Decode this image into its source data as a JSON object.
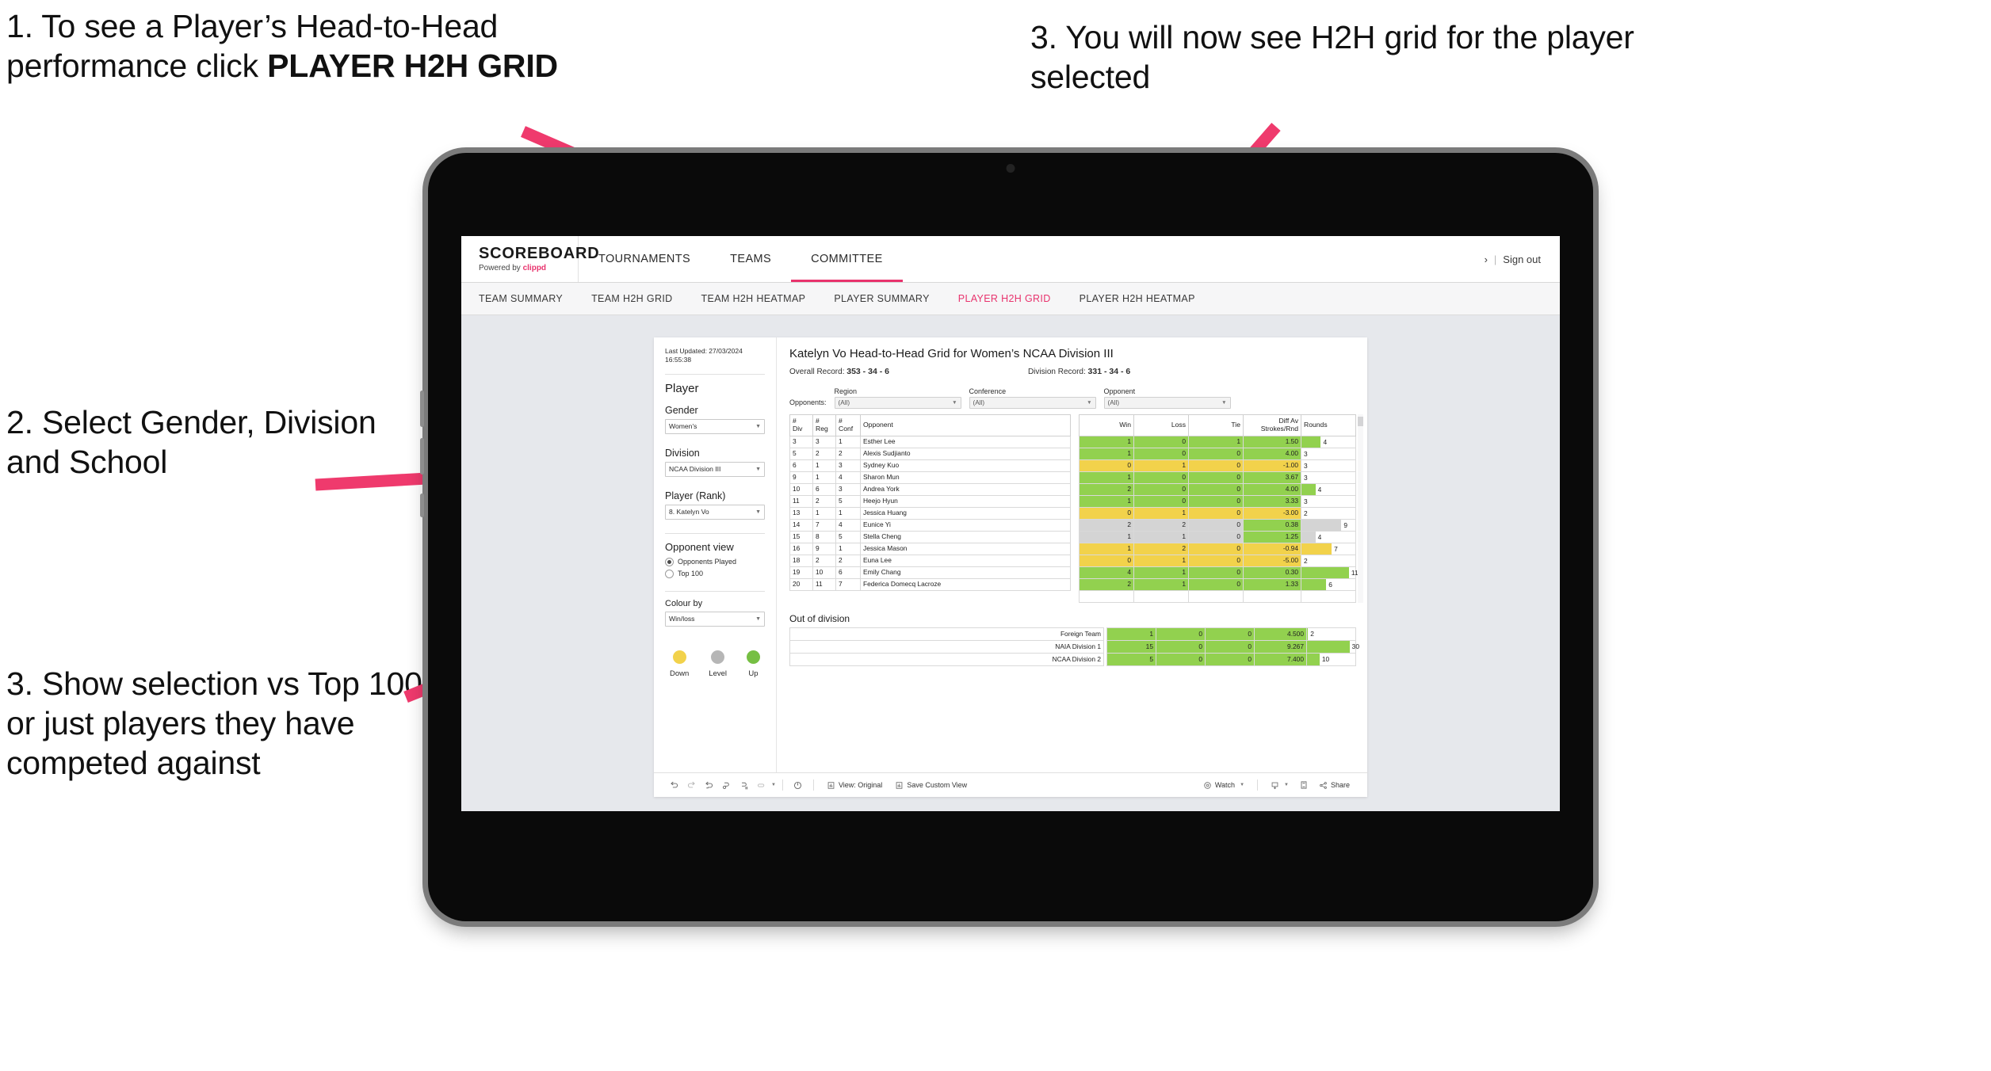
{
  "annotations": {
    "a1_prefix": "1. To see a Player’s Head-to-Head performance click ",
    "a1_bold": "PLAYER H2H GRID",
    "a2": "2. Select Gender, Division and School",
    "a3": "3. Show selection vs Top 100 or just players they have competed against",
    "a4": "3. You will now see H2H grid for the player selected",
    "arrow_color": "#ef3a6d"
  },
  "app": {
    "logo": {
      "main": "SCOREBOARD",
      "powered_prefix": "Powered by ",
      "brand": "clippd"
    },
    "top_nav": [
      {
        "label": "TOURNAMENTS",
        "active": false
      },
      {
        "label": "TEAMS",
        "active": false
      },
      {
        "label": "COMMITTEE",
        "active": true
      }
    ],
    "header_right": {
      "chevron": "›",
      "separator": "|",
      "sign_out": "Sign out"
    },
    "sub_nav": [
      {
        "label": "TEAM SUMMARY",
        "active": false
      },
      {
        "label": "TEAM H2H GRID",
        "active": false
      },
      {
        "label": "TEAM H2H HEATMAP",
        "active": false
      },
      {
        "label": "PLAYER SUMMARY",
        "active": false
      },
      {
        "label": "PLAYER H2H GRID",
        "active": true
      },
      {
        "label": "PLAYER H2H HEATMAP",
        "active": false
      }
    ],
    "accent_color": "#e8336d"
  },
  "sidebar": {
    "last_updated": "Last Updated: 27/03/2024 16:55:38",
    "player_heading": "Player",
    "gender": {
      "label": "Gender",
      "value": "Women's"
    },
    "division": {
      "label": "Division",
      "value": "NCAA Division III"
    },
    "player_rank": {
      "label": "Player (Rank)",
      "value": "8. Katelyn Vo"
    },
    "opponent_view": {
      "heading": "Opponent view",
      "options": [
        {
          "label": "Opponents Played",
          "selected": true
        },
        {
          "label": "Top 100",
          "selected": false
        }
      ]
    },
    "colour_by": {
      "label": "Colour by",
      "value": "Win/loss"
    },
    "legend": [
      {
        "label": "Down",
        "color": "#f2d24b"
      },
      {
        "label": "Level",
        "color": "#b6b6b6"
      },
      {
        "label": "Up",
        "color": "#76bf43"
      }
    ]
  },
  "main": {
    "title": "Katelyn Vo Head-to-Head Grid for Women’s NCAA Division III",
    "overall_record": {
      "label": "Overall Record:",
      "value": "353 - 34 - 6"
    },
    "division_record": {
      "label": "Division Record:",
      "value": "331 - 34 - 6"
    },
    "opponents_label": "Opponents:",
    "filters": [
      {
        "label": "Region",
        "value": "(All)"
      },
      {
        "label": "Conference",
        "value": "(All)"
      },
      {
        "label": "Opponent",
        "value": "(All)"
      }
    ],
    "out_of_division_title": "Out of division"
  },
  "chart_data": {
    "type": "table",
    "title": "Katelyn Vo Head-to-Head Grid for Women’s NCAA Division III",
    "columns": [
      "# Div",
      "# Reg",
      "# Conf",
      "Opponent",
      "Win",
      "Loss",
      "Tie",
      "Diff Av Strokes/Rnd",
      "Rounds"
    ],
    "column_headers_two_line": [
      [
        "#",
        "Div"
      ],
      [
        "#",
        "Reg"
      ],
      [
        "#",
        "Conf"
      ],
      [
        "Opponent",
        ""
      ],
      [
        "Win",
        ""
      ],
      [
        "Loss",
        ""
      ],
      [
        "Tie",
        ""
      ],
      [
        "Diff Av",
        "Strokes/Rnd"
      ],
      [
        "Rounds",
        ""
      ]
    ],
    "rows": [
      {
        "div": "3",
        "reg": "3",
        "conf": "1",
        "opponent": "Esther Lee",
        "win": "1",
        "loss": "0",
        "tie": "1",
        "diff": "1.50",
        "rounds": "4",
        "state": "up",
        "bar_pct": 36
      },
      {
        "div": "5",
        "reg": "2",
        "conf": "2",
        "opponent": "Alexis Sudjianto",
        "win": "1",
        "loss": "0",
        "tie": "0",
        "diff": "4.00",
        "rounds": "3",
        "state": "up",
        "bar_pct": 0
      },
      {
        "div": "6",
        "reg": "1",
        "conf": "3",
        "opponent": "Sydney Kuo",
        "win": "0",
        "loss": "1",
        "tie": "0",
        "diff": "-1.00",
        "rounds": "3",
        "state": "down",
        "bar_pct": 0
      },
      {
        "div": "9",
        "reg": "1",
        "conf": "4",
        "opponent": "Sharon Mun",
        "win": "1",
        "loss": "0",
        "tie": "0",
        "diff": "3.67",
        "rounds": "3",
        "state": "up",
        "bar_pct": 0
      },
      {
        "div": "10",
        "reg": "6",
        "conf": "3",
        "opponent": "Andrea York",
        "win": "2",
        "loss": "0",
        "tie": "0",
        "diff": "4.00",
        "rounds": "4",
        "state": "up",
        "bar_pct": 26
      },
      {
        "div": "11",
        "reg": "2",
        "conf": "5",
        "opponent": "Heejo Hyun",
        "win": "1",
        "loss": "0",
        "tie": "0",
        "diff": "3.33",
        "rounds": "3",
        "state": "up",
        "bar_pct": 0
      },
      {
        "div": "13",
        "reg": "1",
        "conf": "1",
        "opponent": "Jessica Huang",
        "win": "0",
        "loss": "1",
        "tie": "0",
        "diff": "-3.00",
        "rounds": "2",
        "state": "down",
        "bar_pct": 0
      },
      {
        "div": "14",
        "reg": "7",
        "conf": "4",
        "opponent": "Eunice Yi",
        "win": "2",
        "loss": "2",
        "tie": "0",
        "diff": "0.38",
        "rounds": "9",
        "state": "level",
        "bar_pct": 74
      },
      {
        "div": "15",
        "reg": "8",
        "conf": "5",
        "opponent": "Stella Cheng",
        "win": "1",
        "loss": "1",
        "tie": "0",
        "diff": "1.25",
        "rounds": "4",
        "state": "level",
        "bar_pct": 26
      },
      {
        "div": "16",
        "reg": "9",
        "conf": "1",
        "opponent": "Jessica Mason",
        "win": "1",
        "loss": "2",
        "tie": "0",
        "diff": "-0.94",
        "rounds": "7",
        "state": "down",
        "bar_pct": 56
      },
      {
        "div": "18",
        "reg": "2",
        "conf": "2",
        "opponent": "Euna Lee",
        "win": "0",
        "loss": "1",
        "tie": "0",
        "diff": "-5.00",
        "rounds": "2",
        "state": "down",
        "bar_pct": 0
      },
      {
        "div": "19",
        "reg": "10",
        "conf": "6",
        "opponent": "Emily Chang",
        "win": "4",
        "loss": "1",
        "tie": "0",
        "diff": "0.30",
        "rounds": "11",
        "state": "up",
        "bar_pct": 88
      },
      {
        "div": "20",
        "reg": "11",
        "conf": "7",
        "opponent": "Federica Domecq Lacroze",
        "win": "2",
        "loss": "1",
        "tie": "0",
        "diff": "1.33",
        "rounds": "6",
        "state": "up",
        "bar_pct": 46
      }
    ],
    "out_of_division": {
      "title": "Out of division",
      "rows": [
        {
          "name": "Foreign Team",
          "win": "1",
          "loss": "0",
          "tie": "0",
          "diff": "4.500",
          "rounds": "2",
          "state": "up",
          "bar_pct": 2
        },
        {
          "name": "NAIA Division 1",
          "win": "15",
          "loss": "0",
          "tie": "0",
          "diff": "9.267",
          "rounds": "30",
          "state": "up",
          "bar_pct": 88
        },
        {
          "name": "NCAA Division 2",
          "win": "5",
          "loss": "0",
          "tie": "0",
          "diff": "7.400",
          "rounds": "10",
          "state": "up",
          "bar_pct": 26
        }
      ]
    },
    "colors": {
      "up": "#92d14f",
      "down": "#f2d24b",
      "level": "#d4d4d4"
    }
  },
  "toolbar": {
    "undo": "↶",
    "redo": "↷",
    "revert": "↺",
    "refresh": "refresh-data",
    "pause": "pause-updates",
    "view_original": "View: Original",
    "save_custom_view": "Save Custom View",
    "watch": "Watch",
    "share": "Share"
  }
}
